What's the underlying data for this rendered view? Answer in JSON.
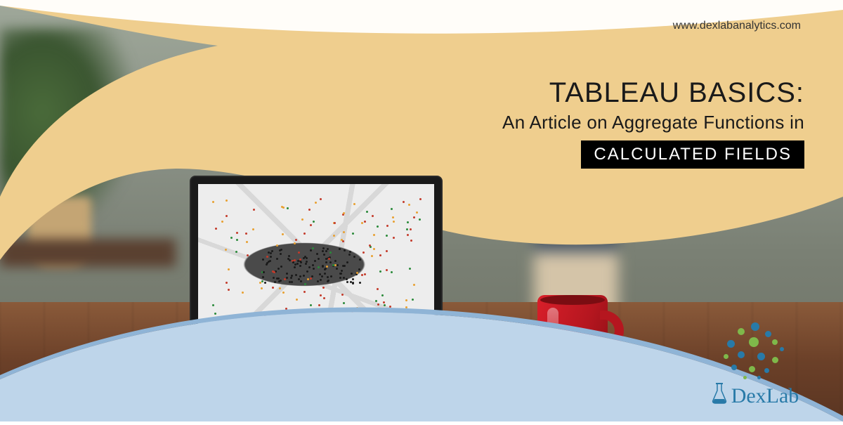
{
  "url": "www.dexlabanalytics.com",
  "title": {
    "main": "TABLEAU BASICS:",
    "sub": "An Article on Aggregate Functions in",
    "badge": "CALCULATED FIELDS"
  },
  "logo": {
    "name": "DexLab"
  },
  "colors": {
    "cream": "#efce8e",
    "blue_light": "#bed5ea",
    "blue_edge": "#8fb4d6",
    "logo_blue": "#287aa8",
    "logo_green": "#7fb84a",
    "mug": "#d91f2a"
  }
}
